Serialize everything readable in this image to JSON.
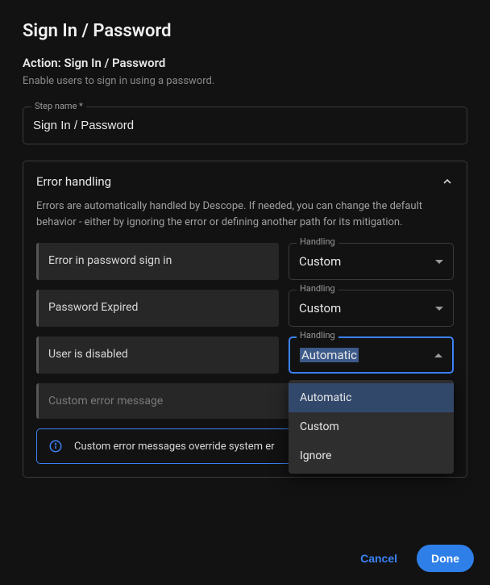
{
  "title": "Sign In / Password",
  "action_label": "Action: Sign In / Password",
  "description": "Enable users to sign in using a password.",
  "step_name": {
    "label": "Step name *",
    "value": "Sign In / Password"
  },
  "error_section": {
    "title": "Error handling",
    "description": "Errors are automatically handled by Descope. If needed, you can change the default behavior - either by ignoring the error or defining another path for its mitigation.",
    "rows": [
      {
        "label": "Error in password sign in",
        "handling_label": "Handling",
        "value": "Custom",
        "open": false
      },
      {
        "label": "Password Expired",
        "handling_label": "Handling",
        "value": "Custom",
        "open": false
      },
      {
        "label": "User is disabled",
        "handling_label": "Handling",
        "value": "Automatic",
        "open": true
      }
    ],
    "custom_message_placeholder": "Custom error message",
    "dropdown_options": [
      "Automatic",
      "Custom",
      "Ignore"
    ],
    "info_text": "Custom error messages override system er"
  },
  "footer": {
    "cancel": "Cancel",
    "done": "Done"
  },
  "colors": {
    "accent": "#3b82f6",
    "background": "#121212",
    "surface": "#272727"
  }
}
